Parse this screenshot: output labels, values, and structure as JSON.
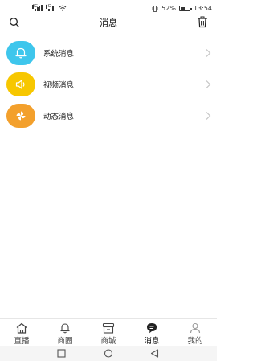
{
  "status_bar": {
    "signal_left_tag": "4G",
    "signal_right_tag": "4G",
    "battery_percent": "52%",
    "battery_level": 0.52,
    "time": "13:54"
  },
  "header": {
    "title": "消息",
    "search_icon": "search-icon",
    "trash_icon": "trash-icon"
  },
  "messages": [
    {
      "label": "系统消息",
      "icon": "bell-icon",
      "color": "#3ec6ec"
    },
    {
      "label": "视频消息",
      "icon": "speaker-icon",
      "color": "#f7c700"
    },
    {
      "label": "动态消息",
      "icon": "pinwheel-icon",
      "color": "#f3a02c"
    }
  ],
  "tabbar": {
    "tabs": [
      {
        "label": "直播",
        "icon": "home-icon",
        "active": false
      },
      {
        "label": "商圈",
        "icon": "bell-outline-icon",
        "active": false
      },
      {
        "label": "商城",
        "icon": "store-icon",
        "active": false
      },
      {
        "label": "消息",
        "icon": "chat-bubble-icon",
        "active": true
      },
      {
        "label": "我的",
        "icon": "person-icon",
        "active": false
      }
    ]
  },
  "navbar": {
    "buttons": [
      "square-button",
      "circle-button",
      "back-triangle-button"
    ]
  }
}
